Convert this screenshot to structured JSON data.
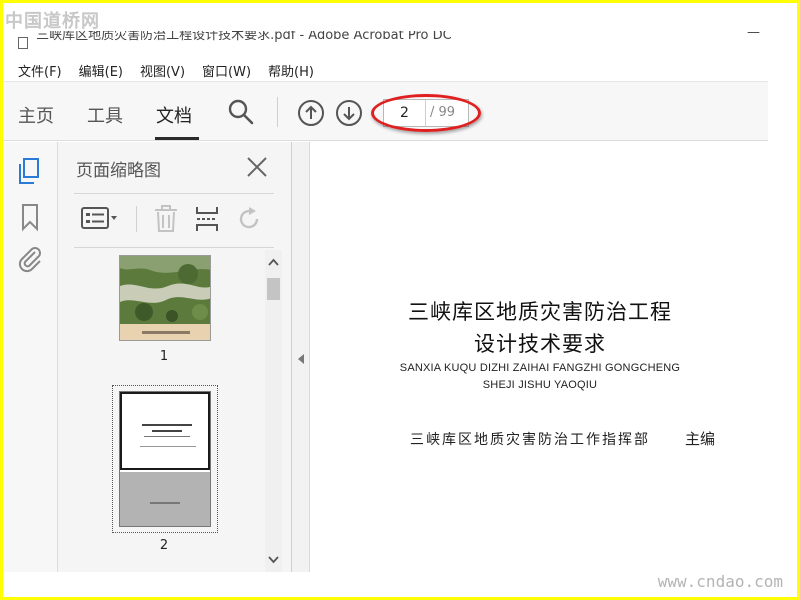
{
  "watermark": {
    "top": "中国道桥网",
    "bottom": "www.cndao.com"
  },
  "window": {
    "title": "三峡库区地质灾害防治工程设计技术要求.pdf - Adobe Acrobat Pro DC"
  },
  "menu": [
    "文件(F)",
    "编辑(E)",
    "视图(V)",
    "窗口(W)",
    "帮助(H)"
  ],
  "tabs": {
    "home": "主页",
    "tools": "工具",
    "document": "文档"
  },
  "toolbar": {
    "search_icon": "search-icon",
    "prev_icon": "arrow-up-circle-icon",
    "next_icon": "arrow-down-circle-icon",
    "page_current": "2",
    "page_total": "/ 99"
  },
  "panel": {
    "title": "页面缩略图",
    "thumbnails": [
      {
        "label": "1"
      },
      {
        "label": "2"
      }
    ]
  },
  "document": {
    "title_line1": "三峡库区地质灾害防治工程",
    "title_line2": "设计技术要求",
    "en_line1": "SANXIA KUQU DIZHI ZAIHAI FANGZHI GONGCHENG",
    "en_line2": "SHEJI JISHU YAOQIU",
    "publisher": "三峡库区地质灾害防治工作指挥部",
    "role": "主编"
  },
  "colors": {
    "highlight_ellipse": "#e02020",
    "frame": "#ffff00"
  }
}
